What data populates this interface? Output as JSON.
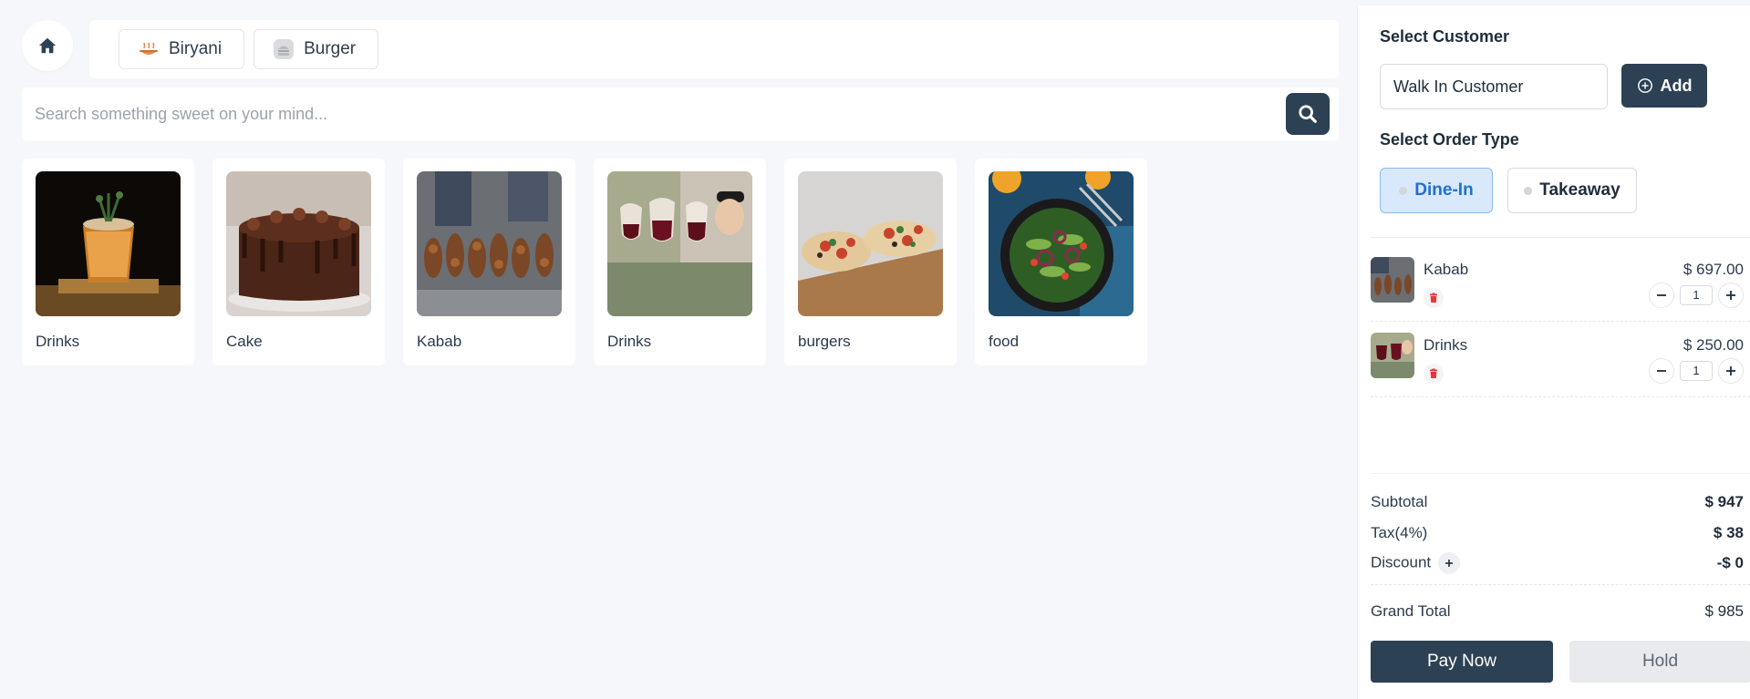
{
  "categories": [
    {
      "label": "Biryani",
      "icon": "biryani-icon"
    },
    {
      "label": "Burger",
      "icon": "burger-icon"
    }
  ],
  "search": {
    "placeholder": "Search something sweet on your mind..."
  },
  "products": [
    {
      "name": "Drinks",
      "image": "drink-glass-photo"
    },
    {
      "name": "Cake",
      "image": "chocolate-cake-photo"
    },
    {
      "name": "Kabab",
      "image": "kabab-skewers-photo"
    },
    {
      "name": "Drinks",
      "image": "wine-glasses-photo"
    },
    {
      "name": "burgers",
      "image": "bruschetta-photo"
    },
    {
      "name": "food",
      "image": "salad-bowl-photo"
    }
  ],
  "panel": {
    "select_customer_label": "Select Customer",
    "customer_value": "Walk In Customer",
    "add_label": "Add",
    "order_type_label": "Select Order Type",
    "order_types": [
      {
        "label": "Dine-In",
        "selected": true
      },
      {
        "label": "Takeaway",
        "selected": false
      }
    ],
    "cart": [
      {
        "name": "Kabab",
        "price": "$ 697.00",
        "qty": "1"
      },
      {
        "name": "Drinks",
        "price": "$ 250.00",
        "qty": "1"
      }
    ],
    "subtotal_label": "Subtotal",
    "subtotal_value": "$ 947",
    "tax_label": "Tax(4%)",
    "tax_value": "$ 38",
    "discount_label": "Discount",
    "discount_value": "-$ 0",
    "grand_total_label": "Grand Total",
    "grand_total_value": "$ 985",
    "pay_now_label": "Pay Now",
    "hold_label": "Hold"
  },
  "colors": {
    "primary": "#2d4154",
    "accent_blue": "#1f6fd1",
    "background": "#f6f7fb",
    "delete_red": "#e53935"
  }
}
